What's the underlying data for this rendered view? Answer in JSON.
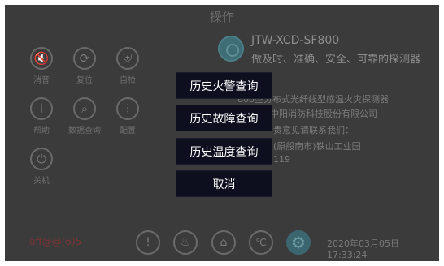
{
  "screen": {
    "title": "操作"
  },
  "buttons": [
    {
      "icon": "speaker-mute-icon",
      "glyph": "🔇",
      "label": "消音"
    },
    {
      "icon": "reset-icon",
      "glyph": "⟳",
      "label": "复位"
    },
    {
      "icon": "shield-check-icon",
      "glyph": "⛨",
      "label": "自检"
    },
    {
      "icon": "info-icon",
      "glyph": "i",
      "label": "帮助"
    },
    {
      "icon": "search-icon",
      "glyph": "⌕",
      "label": "数据查询"
    },
    {
      "icon": "sliders-icon",
      "glyph": "⫶",
      "label": "配置"
    },
    {
      "icon": "power-icon",
      "glyph": "⏻",
      "label": "关机"
    }
  ],
  "device": {
    "model": "JTW-XCD-SF800",
    "slogan": "做及时、准确、安全、可靠的探测器",
    "info_lines": [
      "800型分布式光纤线型感温火灾探测器",
      "中阳消防科技股份有限公司",
      "贵意见请联系我们：",
      "(原般南市)铁山工业园",
      "119"
    ]
  },
  "status_bar": {
    "left_text": "off@@(6)5",
    "icons": [
      {
        "name": "alarm-icon",
        "glyph": "!"
      },
      {
        "name": "fire-icon",
        "glyph": "♨"
      },
      {
        "name": "home-icon",
        "glyph": "⌂"
      },
      {
        "name": "temperature-icon",
        "glyph": "℃"
      }
    ],
    "datetime": "2020年03月05日 17:33:24"
  },
  "menu": {
    "items": [
      "历史火警查询",
      "历史故障查询",
      "历史温度查询"
    ],
    "cancel": "取消"
  },
  "colors": {
    "overlay": "#3b3b3b",
    "menu_button": "#0d0f1f",
    "menu_text": "#ffffff"
  }
}
